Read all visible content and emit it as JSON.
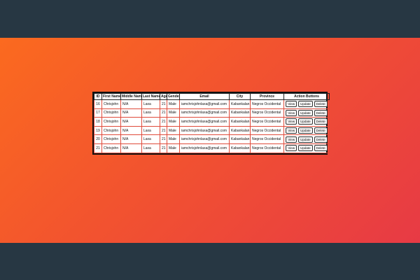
{
  "table": {
    "headers": [
      "ID",
      "First Name",
      "Middle Name",
      "Last Name",
      "Age",
      "Gender",
      "Email",
      "City",
      "Province",
      "Action Buttons"
    ],
    "rows": [
      {
        "id": "16",
        "first": "Chrisjohn",
        "middle": "N/A",
        "last": "Laxa",
        "age": "21",
        "gender": "Male",
        "email": "iamchrisjohnlaxa@gmail.com",
        "city": "Kabankalan",
        "province": "Negros Occidental"
      },
      {
        "id": "17",
        "first": "Chrisjohn",
        "middle": "N/A",
        "last": "Laxa",
        "age": "21",
        "gender": "Male",
        "email": "iamchrisjohnlaxa@gmail.com",
        "city": "Kabankalan",
        "province": "Negros Occidental"
      },
      {
        "id": "18",
        "first": "Chrisjohn",
        "middle": "N/A",
        "last": "Laxa",
        "age": "21",
        "gender": "Male",
        "email": "iamchrisjohnlaxa@gmail.com",
        "city": "Kabankalan",
        "province": "Negros Occidental"
      },
      {
        "id": "19",
        "first": "Chrisjohn",
        "middle": "N/A",
        "last": "Laxa",
        "age": "21",
        "gender": "Male",
        "email": "iamchrisjohnlaxa@gmail.com",
        "city": "Kabankalan",
        "province": "Negros Occidental"
      },
      {
        "id": "20",
        "first": "Chrisjohn",
        "middle": "N/A",
        "last": "Laxa",
        "age": "21",
        "gender": "Male",
        "email": "iamchrisjohnlaxa@gmail.com",
        "city": "Kabankalan",
        "province": "Negros Occidental"
      },
      {
        "id": "21",
        "first": "Chrisjohn",
        "middle": "N/A",
        "last": "Laxa",
        "age": "21",
        "gender": "Male",
        "email": "iamchrisjohnlaxa@gmail.com",
        "city": "Kabankalan",
        "province": "Negros Occidental"
      }
    ],
    "actions": {
      "view": "View",
      "update": "Update",
      "delete": "Delete"
    }
  },
  "colors": {
    "frame": "#273743",
    "gradient_start": "#fb6a1f",
    "gradient_end": "#e73a45",
    "cell_border": "#e04a3a"
  }
}
